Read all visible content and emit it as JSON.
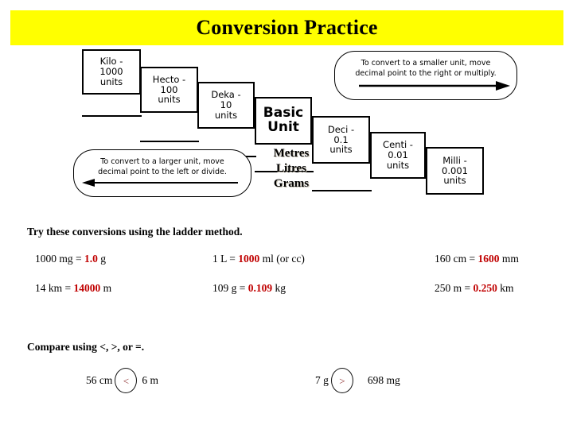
{
  "title": {
    "text": "Conversion Practice",
    "banner_color": "#FFFF00",
    "text_color": "#000000"
  },
  "ladder": {
    "steps": [
      {
        "name": "kilo",
        "line1": "Kilo -",
        "line2": "1000",
        "line3": "units"
      },
      {
        "name": "hecto",
        "line1": "Hecto -",
        "line2": "100",
        "line3": "units"
      },
      {
        "name": "deka",
        "line1": "Deka -",
        "line2": "10",
        "line3": "units"
      },
      {
        "name": "basic",
        "line1": "Basic",
        "line2": "Unit",
        "line3": ""
      },
      {
        "name": "deci",
        "line1": "Deci -",
        "line2": "0.1",
        "line3": "units"
      },
      {
        "name": "centi",
        "line1": "Centi -",
        "line2": "0.01",
        "line3": "units"
      },
      {
        "name": "milli",
        "line1": "Milli -",
        "line2": "0.001",
        "line3": "units"
      }
    ],
    "basic_unit_caption": {
      "line1": "Metres",
      "line2": "Litres",
      "line3": "Grams"
    },
    "callout_left": {
      "line1": "To convert to a larger unit, move",
      "line2": "decimal  point to the left or divide.",
      "arrow_direction": "left"
    },
    "callout_right": {
      "line1": "To convert to a smaller unit, move",
      "line2": "decimal  point to the right or multiply.",
      "arrow_direction": "right"
    }
  },
  "prompts": {
    "conversions": "Try these conversions using the ladder method.",
    "comparisons": "Compare using <, >, or =."
  },
  "conversions": {
    "answer_color": "#C00000",
    "rows": [
      [
        {
          "before": "1000 mg = ",
          "answer": "1.0",
          "after": " g"
        },
        {
          "before": "1 L = ",
          "answer": "1000",
          "after": " ml (or cc)"
        },
        {
          "before": "160 cm = ",
          "answer": "1600",
          "after": " mm"
        }
      ],
      [
        {
          "before": "14 km = ",
          "answer": "14000",
          "after": " m"
        },
        {
          "before": "109 g = ",
          "answer": "0.109",
          "after": " kg"
        },
        {
          "before": "250 m = ",
          "answer": "0.250",
          "after": " km"
        }
      ]
    ]
  },
  "comparisons": {
    "symbol_color": "#8B2A2A",
    "items": [
      {
        "left": "56 cm",
        "symbol": "<",
        "right": "6 m"
      },
      {
        "left": "7 g",
        "symbol": ">",
        "right": "698 mg"
      }
    ]
  }
}
